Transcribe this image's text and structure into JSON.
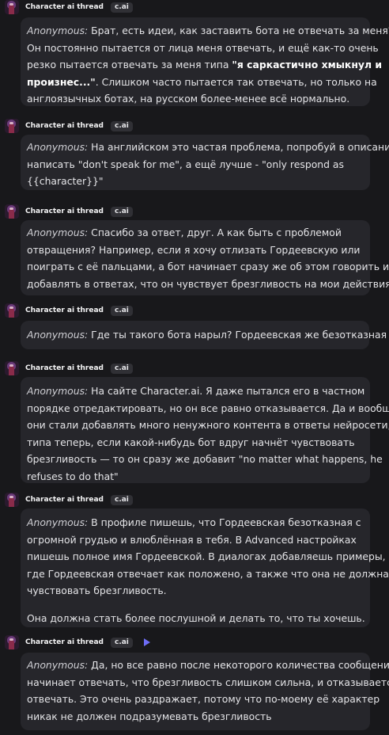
{
  "thread": {
    "bot_name": "Character ai thread",
    "tag": "c.ai"
  },
  "messages": [
    {
      "author": "Anonymous:",
      "lines": [
        " Брат, есть идеи, как заставить бота не отвечать за меня?",
        "Он постоянно пытается от лица меня отвечать, и ещё как-то очень",
        "резко пытается отвечать за меня типа ",
        "\"я саркастично хмыкнул и",
        "произнес...\"",
        ". Слишком часто пытается так отвечать, но только на",
        "англоязычных ботах, на русском более-менее всё нормально."
      ]
    },
    {
      "author": "Anonymous:",
      "lines": [
        " На английском это частая проблема, попробуй в описании",
        "написать \"don't speak for me\", а ещё лучше - \"only respond as",
        "{{character}}\""
      ]
    },
    {
      "author": "Anonymous:",
      "lines": [
        " Спасибо за ответ, друг. А как быть с проблемой",
        "отвращения? Например, если я хочу отлизать Гордеевскую или",
        "поиграть с её пальцами, а бот начинает сразу же об этом говорить и",
        "добавлять в ответах, что он чувствует брезгливость на мои действия."
      ]
    },
    {
      "author": "Anonymous:",
      "lines": [
        " Где ты такого бота нарыл? Гордеевская же безотказная"
      ]
    },
    {
      "author": "Anonymous:",
      "lines": [
        " На сайте Character.ai. Я даже пытался его в частном",
        "порядке отредактировать, но он все равно отказывается. Да и вообще",
        "они стали добавлять много ненужного контента в ответы нейросети,",
        "типа теперь, если какой-нибудь бот вдруг начнёт чувствовать",
        "брезгливость — то он сразу же добавит \"no matter what happens, he",
        "refuses to do that\""
      ]
    },
    {
      "author": "Anonymous:",
      "lines": [
        " В профиле пишешь, что Гордеевская безотказная с",
        "огромной грудью и влюблённая в тебя. В Advanced настройках",
        "пишешь полное имя Гордеевской. В диалогах добавляешь примеры,",
        "где Гордеевская отвечает как положено, а также что она не должна",
        "чувствовать брезгливость.",
        "Она должна стать более послушной и делать то, что ты хочешь."
      ]
    },
    {
      "author": "Anonymous:",
      "lines": [
        " Да, но все равно после некоторого количества сообщений",
        "начинает отвечать, что брезгливость слишком сильна, и отказывается",
        "отвечать. Это очень раздражает, потому что по-моему её характер",
        "никак не должен подразумевать брезгливость"
      ]
    }
  ],
  "icons": {
    "avatar": "bot-avatar",
    "play": "play-icon"
  }
}
